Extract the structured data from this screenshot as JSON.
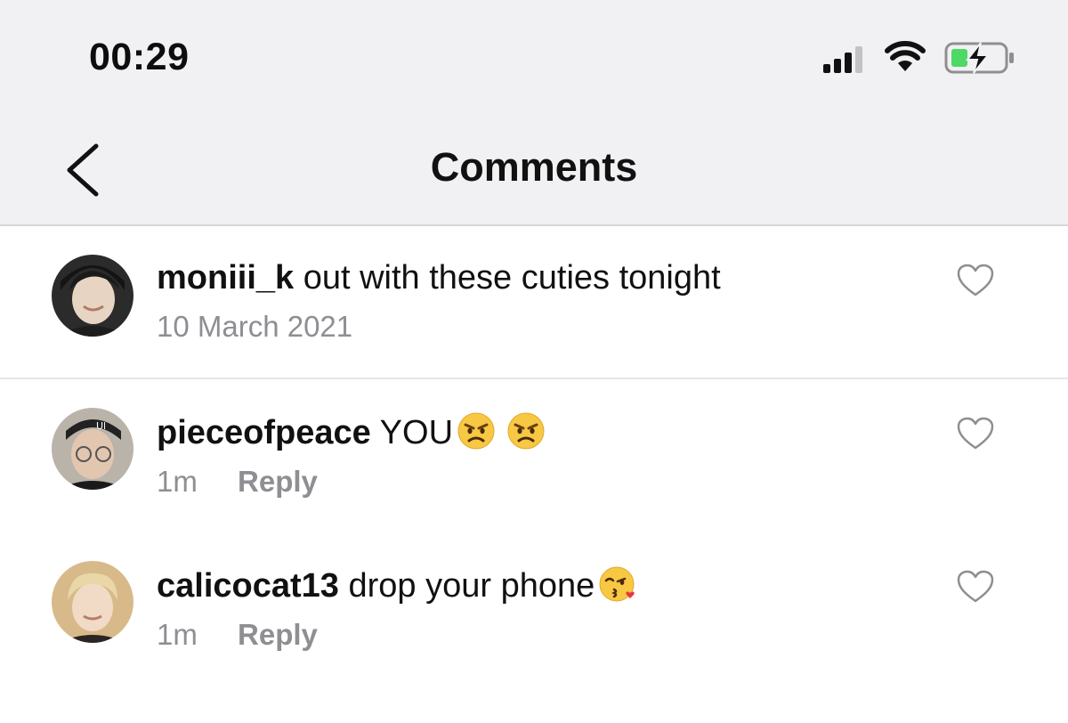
{
  "status_bar": {
    "time": "00:29",
    "icons": [
      "cellular-signal-icon",
      "wifi-icon",
      "battery-charging-icon"
    ]
  },
  "nav": {
    "title": "Comments",
    "back_icon": "chevron-left-icon"
  },
  "caption": {
    "username": "moniii_k",
    "text": "out with these cuties tonight",
    "date": "10 March 2021"
  },
  "comments": [
    {
      "username": "pieceofpeace",
      "text": "YOU",
      "emojis": [
        "angry-face-emoji",
        "angry-face-emoji"
      ],
      "time": "1m",
      "reply_label": "Reply"
    },
    {
      "username": "calicocat13",
      "text": "drop your phone",
      "emojis": [
        "face-blowing-kiss-emoji"
      ],
      "time": "1m",
      "reply_label": "Reply"
    }
  ],
  "colors": {
    "header_bg": "#f1f1f3",
    "meta_text": "#8e8e93",
    "battery_fill": "#4cd964"
  }
}
